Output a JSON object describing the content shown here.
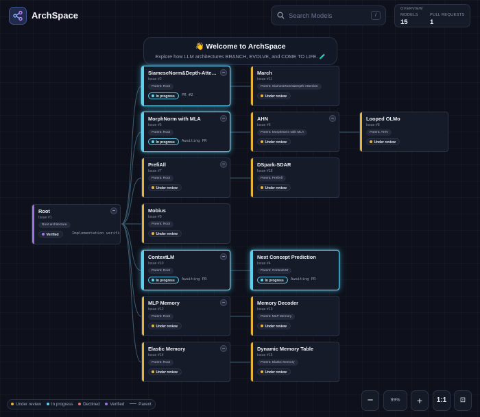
{
  "app": {
    "title": "ArchSpace"
  },
  "search": {
    "placeholder": "Search Models",
    "shortcut": "/"
  },
  "overview": {
    "title": "OVERVIEW",
    "models_label": "MODELS",
    "models_value": "15",
    "prs_label": "PULL REQUESTS",
    "prs_value": "1"
  },
  "welcome": {
    "title": "👋 Welcome to ArchSpace",
    "subtitle": "Explore how LLM architectures BRANCH, EVOLVE, and COME TO LIFE. 🧪"
  },
  "status_labels": {
    "review": "Under review",
    "progress": "In progress",
    "verified": "Verified"
  },
  "colors": {
    "review": "#e8b436",
    "progress": "#5ad2ee",
    "declined": "#e07575",
    "verified": "#a372e6",
    "edge": "#3d5e72"
  },
  "nodes": [
    {
      "title": "Root",
      "issue": "Issue #1",
      "parent": "Root architecture",
      "status": "verified",
      "note": "Implementation verified",
      "collapse": true
    },
    {
      "title": "SiameseNorm&Depth-Attention",
      "issue": "Issue #2",
      "parent": "Parent: Root",
      "status": "progress",
      "note": "PR #2",
      "collapse": true
    },
    {
      "title": "MorphNorm with MLA",
      "issue": "Issue #5",
      "parent": "Parent: Root",
      "status": "progress",
      "note": "Awaiting PR",
      "collapse": true
    },
    {
      "title": "PrefiAll",
      "issue": "Issue #7",
      "parent": "Parent: Root",
      "status": "review",
      "note": "",
      "collapse": true
    },
    {
      "title": "Mobius",
      "issue": "Issue #9",
      "parent": "Parent: Root",
      "status": "review",
      "note": "",
      "collapse": false
    },
    {
      "title": "ContextLM",
      "issue": "Issue #10",
      "parent": "Parent: Root",
      "status": "progress",
      "note": "Awaiting PR",
      "collapse": true
    },
    {
      "title": "MLP Memory",
      "issue": "Issue #12",
      "parent": "Parent: Root",
      "status": "review",
      "note": "",
      "collapse": true
    },
    {
      "title": "Elastic Memory",
      "issue": "Issue #14",
      "parent": "Parent: Root",
      "status": "review",
      "note": "",
      "collapse": true
    },
    {
      "title": "March",
      "issue": "Issue #11",
      "parent": "Parent: SiameseNorm&Depth-Attention",
      "status": "review",
      "note": "",
      "collapse": false
    },
    {
      "title": "AHN",
      "issue": "Issue #6",
      "parent": "Parent: MorphNorm with MLA",
      "status": "review",
      "note": "",
      "collapse": true
    },
    {
      "title": "DSpark-SDAR",
      "issue": "Issue #18",
      "parent": "Parent: PrefiAll",
      "status": "review",
      "note": "",
      "collapse": false
    },
    {
      "title": "Next Concept Prediction",
      "issue": "Issue #4",
      "parent": "Parent: ContextLM",
      "status": "progress",
      "note": "Awaiting PR",
      "collapse": false
    },
    {
      "title": "Memory Decoder",
      "issue": "Issue #13",
      "parent": "Parent: MLP Memory",
      "status": "review",
      "note": "",
      "collapse": false
    },
    {
      "title": "Dynamic Memory Table",
      "issue": "Issue #15",
      "parent": "Parent: Elastic Memory",
      "status": "review",
      "note": "",
      "collapse": false
    },
    {
      "title": "Looped OLMo",
      "issue": "Issue #8",
      "parent": "Parent: AHN",
      "status": "review",
      "note": "",
      "collapse": false
    }
  ],
  "legend": {
    "review": "Under review",
    "progress": "In progress",
    "declined": "Declined",
    "verified": "Verified",
    "parent": "Parent"
  },
  "zoom": {
    "out": "−",
    "level": "99%",
    "in": "+",
    "reset": "1:1",
    "fit": "⊡"
  }
}
